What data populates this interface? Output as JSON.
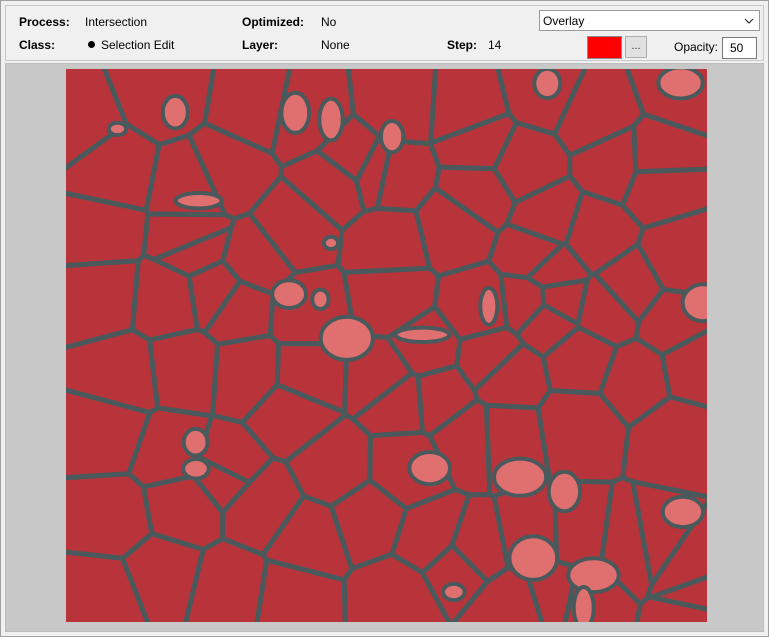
{
  "info": {
    "process_label": "Process:",
    "process_value": "Intersection",
    "class_label": "Class:",
    "class_value": "Selection Edit",
    "optimized_label": "Optimized:",
    "optimized_value": "No",
    "layer_label": "Layer:",
    "layer_value": "None",
    "step_label": "Step:",
    "step_value": "14"
  },
  "controls": {
    "display_mode": "Overlay",
    "overlay_color": "#ff0000",
    "more_button_label": "...",
    "opacity_label": "Opacity:",
    "opacity_value": "50"
  },
  "overlay": {
    "region_color": "#b8343a",
    "boundary_color": "#4a5a5c",
    "highlight_color": "#e07070"
  }
}
